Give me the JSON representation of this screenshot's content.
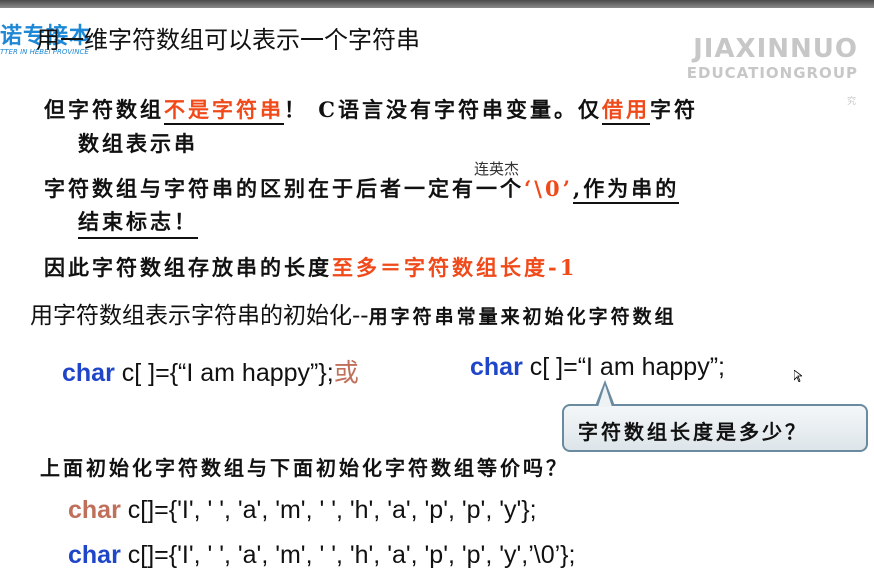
{
  "logo": {
    "cn": "诺专接本",
    "en": "TTER IN HEBEI PROVINCE"
  },
  "watermark": {
    "line1": "JIAXINNUO",
    "line2": "EDUCATIONGROUP",
    "line3": "究"
  },
  "title": "用一维字符数组可以表示一个字符串",
  "notes": {
    "line1_a": "但字符数组",
    "line1_red": "不是字符串",
    "line1_b": "！ C语言没有字符串变量。仅",
    "line1_red2": "借用",
    "line1_c": "字符",
    "line1b": "数组表示串",
    "line2_a": "字符数组与字符串的区别在于后者一定有一个",
    "line2_red": "‘\\0’",
    "line2_b": ",作为串的",
    "line2b": "结束标志！",
    "line3_a": "因此字符数组存放串的长度",
    "line3_red": "至多＝字符数组长度-1"
  },
  "signature": "连英杰",
  "heading2": {
    "main": "用字符数组表示字符串的初始化--",
    "hand": "用字符串常量来初始化字符数组"
  },
  "code1": {
    "kw": "char",
    "rest": " c[ ]={“I am happy”};",
    "or": "或"
  },
  "code2": {
    "kw": "char",
    "rest": " c[ ]=“I am happy”;"
  },
  "callout": "字符数组长度是多少？",
  "question": "上面初始化字符数组与下面初始化字符数组等价吗？",
  "code3": {
    "kw": "char",
    "rest": " c[]={'I', ' ', 'a', 'm', ' ', 'h', 'a', 'p', 'p', 'y'};"
  },
  "code4": {
    "kw": "char",
    "rest": " c[]={'I', ' ', 'a', 'm', ' ', 'h', 'a', 'p', 'p', 'y',’\\0’};"
  },
  "colors": {
    "red": "#f04a1a",
    "blue_keyword": "#1f45c8",
    "brown_keyword": "#c0705a",
    "logo_blue": "#1e88d6"
  }
}
